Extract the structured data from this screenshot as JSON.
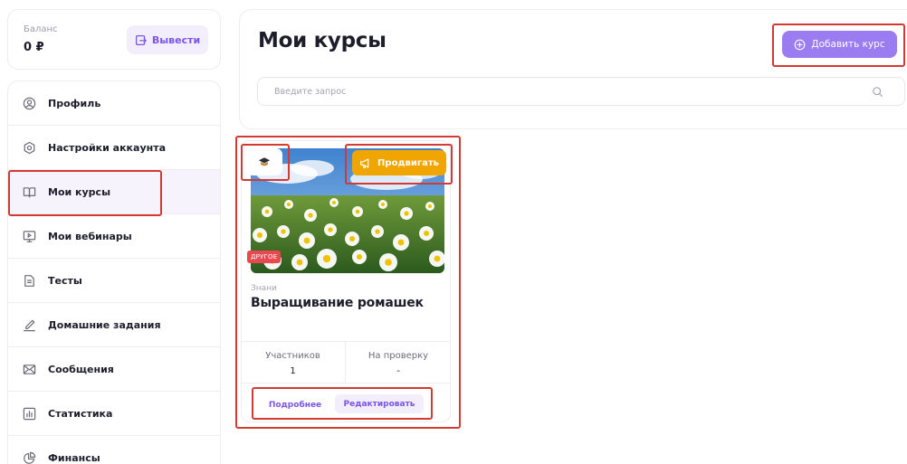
{
  "balance": {
    "label": "Баланс",
    "value": "0 ₽",
    "withdraw_label": "Вывести"
  },
  "sidebar": {
    "items": [
      {
        "label": "Профиль",
        "icon": "user-circle-icon"
      },
      {
        "label": "Настройки аккаунта",
        "icon": "gear-icon"
      },
      {
        "label": "Мои курсы",
        "icon": "book-icon"
      },
      {
        "label": "Мои вебинары",
        "icon": "monitor-play-icon"
      },
      {
        "label": "Тесты",
        "icon": "document-icon"
      },
      {
        "label": "Домашние задания",
        "icon": "pen-icon"
      },
      {
        "label": "Сообщения",
        "icon": "envelope-icon"
      },
      {
        "label": "Статистика",
        "icon": "bar-chart-icon"
      },
      {
        "label": "Финансы",
        "icon": "pie-chart-icon"
      }
    ],
    "active_item": "Мои курсы"
  },
  "main": {
    "title": "Мои курсы",
    "add_course_label": "Добавить курс",
    "search": {
      "placeholder": "Введите запрос",
      "value": ""
    }
  },
  "course": {
    "promote_label": "Продвигать",
    "category": "ДРУГОЕ",
    "author": "Знани",
    "title": "Выращивание ромашек",
    "stats": [
      {
        "label": "Участников",
        "value": "1"
      },
      {
        "label": "На проверку",
        "value": "-"
      }
    ],
    "details_label": "Подробнее",
    "edit_label": "Редактировать"
  },
  "colors": {
    "accent": "#9b7cf1",
    "accent_text": "#7b54e6",
    "promote": "#f0a500",
    "category_tag": "#e8484f",
    "highlight": "#d33a33"
  }
}
